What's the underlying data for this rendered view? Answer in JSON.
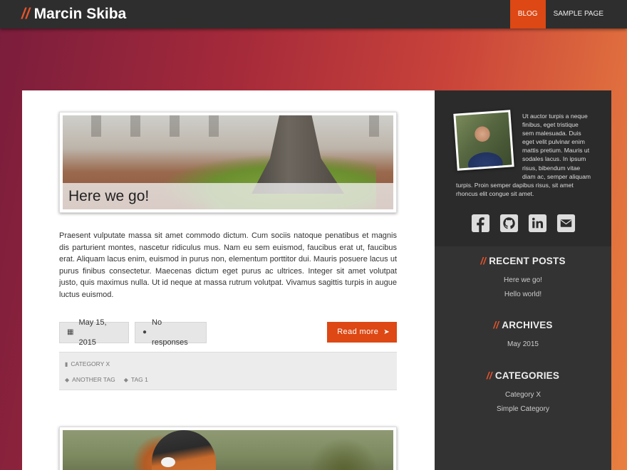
{
  "site": {
    "brand_prefix": "//",
    "title": "Marcin Skiba"
  },
  "nav": {
    "items": [
      "BLOG",
      "SAMPLE PAGE"
    ],
    "active": "BLOG"
  },
  "post1": {
    "caption": "Here we go!",
    "excerpt": "Praesent vulputate massa sit amet commodo dictum. Cum sociis natoque penatibus et magnis dis parturient montes, nascetur ridiculus mus. Nam eu sem euismod, faucibus erat ut, faucibus erat. Aliquam lacus enim, euismod in purus non, elementum porttitor dui. Mauris posuere lacus ut purus finibus consectetur. Maecenas dictum eget purus ac ultrices. Integer sit amet volutpat justo, quis maximus nulla. Ut id neque at massa rutrum volutpat. Vivamus sagittis turpis in augue luctus euismod.",
    "date": "May 15, 2015",
    "responses": "No responses",
    "read_more": "Read more",
    "category": "CATEGORY X",
    "tags": [
      "ANOTHER TAG",
      "TAG 1"
    ]
  },
  "sidebar": {
    "about": "Ut auctor turpis a neque finibus, eget tristique sem malesuada. Duis eget velit pulvinar enim mattis pretium. Mauris ut sodales lacus. In ipsum risus, bibendum vitae diam ac, semper aliquam turpis. Proin semper dapibus risus, sit amet rhoncus elit congue sit amet.",
    "social_icons": [
      "facebook-icon",
      "github-icon",
      "linkedin-icon",
      "email-icon"
    ],
    "recent_posts": {
      "prefix": "//",
      "title": "RECENT POSTS",
      "items": [
        "Here we go!",
        "Hello world!"
      ]
    },
    "archives": {
      "prefix": "//",
      "title": "ARCHIVES",
      "items": [
        "May 2015"
      ]
    },
    "categories": {
      "prefix": "//",
      "title": "CATEGORIES",
      "items": [
        "Category X",
        "Simple Category"
      ]
    }
  },
  "colors": {
    "accent": "#dd4814",
    "topbar": "#2e2e2e",
    "sidebar": "#333333"
  }
}
